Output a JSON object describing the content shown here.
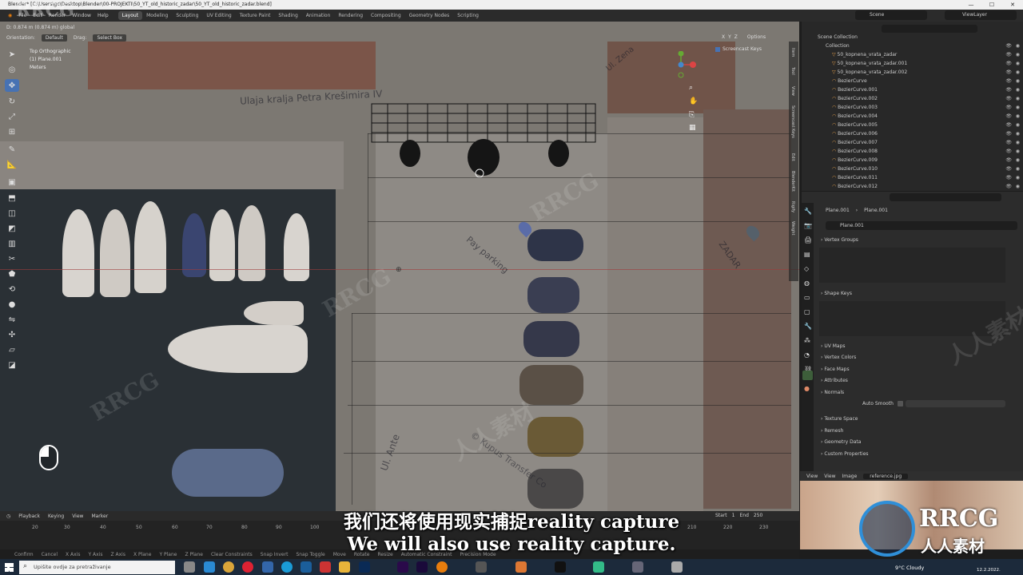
{
  "titlebar": {
    "title": "Blender* [C:\\Users\\gc\\Desktop\\Blender\\00-PROJEKTI\\50_YT_old_historic_zadar\\50_YT_old_historic_zadar.blend]",
    "min": "—",
    "max": "☐",
    "close": "✕"
  },
  "menubar": {
    "menus": [
      "File",
      "Edit",
      "Render",
      "Window",
      "Help"
    ],
    "workspaces": [
      "Layout",
      "Modeling",
      "Sculpting",
      "UV Editing",
      "Texture Paint",
      "Shading",
      "Animation",
      "Rendering",
      "Compositing",
      "Geometry Nodes",
      "Scripting"
    ],
    "active_workspace": "Layout",
    "scene": "Scene",
    "view_layer": "ViewLayer"
  },
  "viewport": {
    "coords": "D: 0.874 m (0.874 m) global",
    "orientation_label": "Orientation:",
    "orientation": "Default",
    "drag_label": "Drag:",
    "drag": "Select Box",
    "view_name": "Top Orthographic",
    "object_name": "(1) Plane.001",
    "units": "Meters",
    "options": "Options",
    "screencast_keys": "Screencast Keys",
    "axes": {
      "x": "X",
      "y": "Y",
      "z": "Z"
    },
    "side_tabs": [
      "Item",
      "Tool",
      "View",
      "Screencast Keys",
      "Edit",
      "BlenderKit",
      "Rigify",
      "Weight"
    ],
    "map_labels": {
      "top_street": "Ulaja kralja Petra Krešimira IV",
      "parking": "Pay parking",
      "zadar": "ZADAR",
      "street": "Ul. Ante",
      "credit": "© Kupus Transfer Co",
      "right_street": "Ul. Zena"
    }
  },
  "outliner": {
    "search_placeholder": "",
    "scene_collection": "Scene Collection",
    "collection": "Collection",
    "items": [
      "50_kopnena_vrata_zadar",
      "50_kopnena_vrata_zadar.001",
      "50_kopnena_vrata_zadar.002",
      "BezierCurve",
      "BezierCurve.001",
      "BezierCurve.002",
      "BezierCurve.003",
      "BezierCurve.004",
      "BezierCurve.005",
      "BezierCurve.006",
      "BezierCurve.007",
      "BezierCurve.008",
      "BezierCurve.009",
      "BezierCurve.010",
      "BezierCurve.011",
      "BezierCurve.012"
    ]
  },
  "properties": {
    "breadcrumb_a": "Plane.001",
    "breadcrumb_b": "Plane.001",
    "data_name": "Plane.001",
    "sections": [
      "Vertex Groups",
      "Shape Keys",
      "UV Maps",
      "Vertex Colors",
      "Face Maps",
      "Attributes",
      "Normals",
      "Texture Space",
      "Remesh",
      "Geometry Data",
      "Custom Properties"
    ],
    "auto_smooth": "Auto Smooth"
  },
  "timeline": {
    "menus": [
      "Playback",
      "Keying",
      "View",
      "Marker"
    ],
    "start_label": "Start",
    "start": "1",
    "end_label": "End",
    "end": "250",
    "ticks": [
      "20",
      "30",
      "40",
      "50",
      "60",
      "70",
      "80",
      "90",
      "100",
      "210",
      "220",
      "230"
    ]
  },
  "statusbar": {
    "items": [
      "Confirm",
      "Cancel",
      "X Axis",
      "Y Axis",
      "Z Axis",
      "X Plane",
      "Y Plane",
      "Z Plane",
      "Clear Constraints",
      "Snap Invert",
      "Snap Toggle",
      "Move",
      "Rotate",
      "Resize",
      "Automatic Constraint",
      "Precision Mode"
    ]
  },
  "reference": {
    "view": "View",
    "view2": "View",
    "image": "Image",
    "filename": "reference.jpg"
  },
  "subtitles": {
    "zh": "我们还将使用现实捕捉reality capture",
    "en": "We will also use reality capture."
  },
  "taskbar": {
    "search_placeholder": "Upišite ovdje za pretraživanje",
    "weather": "9°C  Cloudy",
    "date": "12.2.2022."
  },
  "watermark": {
    "brand": "RRCG",
    "cn": "人人素材"
  },
  "colors": {
    "accent": "#4772b3",
    "taskbar": "#1c2a3b"
  }
}
